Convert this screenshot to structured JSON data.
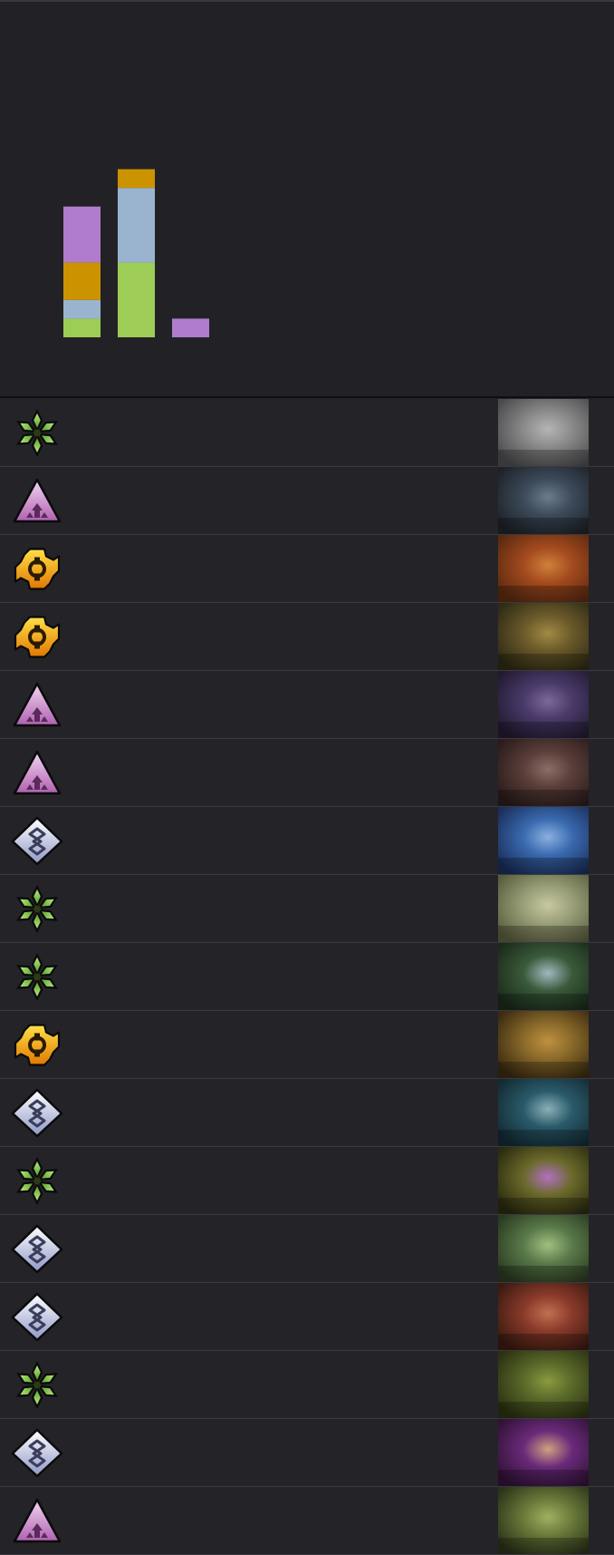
{
  "colors": {
    "background": "#222226",
    "row_background": "#232328",
    "row_border": "#3a3a40",
    "green": "#9dcd56",
    "blue": "#9ab4d0",
    "orange": "#cc9300",
    "purple": "#b07ccc"
  },
  "chart_data": {
    "type": "bar",
    "stacked": true,
    "categories": [
      "",
      "",
      ""
    ],
    "series": [
      {
        "color": "#9dcd56",
        "values": [
          1,
          4,
          0
        ]
      },
      {
        "color": "#9ab4d0",
        "values": [
          1,
          4,
          0
        ]
      },
      {
        "color": "#cc9300",
        "values": [
          2,
          1,
          0
        ]
      },
      {
        "color": "#b07ccc",
        "values": [
          3,
          0,
          1
        ]
      }
    ],
    "ylim": [
      0,
      10
    ],
    "grid": false,
    "legend": "none"
  },
  "rows": [
    {
      "type": "green-clover-icon",
      "art": "gray-rat-creature-art",
      "palette": [
        "#8a8a8a",
        "#4b4b4e",
        "#b5b5b5"
      ]
    },
    {
      "type": "purple-triangle-icon",
      "art": "dark-tentacle-beast-art",
      "palette": [
        "#3c4a5a",
        "#1e2228",
        "#6b7c8a"
      ]
    },
    {
      "type": "orange-gear-icon",
      "art": "red-hooded-tinker-art",
      "palette": [
        "#a44a1e",
        "#5a2a10",
        "#d0803a"
      ]
    },
    {
      "type": "orange-gear-icon",
      "art": "bronze-egg-device-art",
      "palette": [
        "#6b5a2a",
        "#2e2a14",
        "#a08a44"
      ]
    },
    {
      "type": "purple-triangle-icon",
      "art": "purple-mech-golem-art",
      "palette": [
        "#4a3a6a",
        "#221a30",
        "#7a6a9a"
      ]
    },
    {
      "type": "purple-triangle-icon",
      "art": "stone-grub-creature-art",
      "palette": [
        "#5a3e3a",
        "#2a1c1a",
        "#8a6e66"
      ]
    },
    {
      "type": "silver-diamond-icon",
      "art": "blue-sky-banner-art",
      "palette": [
        "#3a6ab0",
        "#1a2e5a",
        "#8ab0e0"
      ]
    },
    {
      "type": "green-clover-icon",
      "art": "stone-idol-art",
      "palette": [
        "#9aa07a",
        "#5a5e3e",
        "#c8c8a0"
      ]
    },
    {
      "type": "green-clover-icon",
      "art": "water-fountain-art",
      "palette": [
        "#3a5a3a",
        "#1a2a1a",
        "#a0b8c0"
      ]
    },
    {
      "type": "orange-gear-icon",
      "art": "armored-knight-art",
      "palette": [
        "#8a6a2a",
        "#3a2a10",
        "#c09040"
      ]
    },
    {
      "type": "silver-diamond-icon",
      "art": "stone-statue-art",
      "palette": [
        "#2a5a6a",
        "#122a32",
        "#8ab0b8"
      ]
    },
    {
      "type": "green-clover-icon",
      "art": "purple-flower-vine-art",
      "palette": [
        "#6a6a2a",
        "#2a2a10",
        "#b070c0"
      ]
    },
    {
      "type": "silver-diamond-icon",
      "art": "green-giant-warrior-art",
      "palette": [
        "#5a7a4a",
        "#2a3a20",
        "#a0c080"
      ]
    },
    {
      "type": "silver-diamond-icon",
      "art": "red-army-soldiers-art",
      "palette": [
        "#8a3a2a",
        "#3a1a10",
        "#c07050"
      ]
    },
    {
      "type": "green-clover-icon",
      "art": "green-forest-face-art",
      "palette": [
        "#5a6a2a",
        "#2a3010",
        "#8a9a40"
      ]
    },
    {
      "type": "silver-diamond-icon",
      "art": "royal-figures-art",
      "palette": [
        "#6a2a7a",
        "#301236",
        "#d0a080"
      ]
    },
    {
      "type": "purple-triangle-icon",
      "art": "green-cannon-art",
      "palette": [
        "#6a7a3a",
        "#2a3218",
        "#a0b060"
      ]
    }
  ]
}
